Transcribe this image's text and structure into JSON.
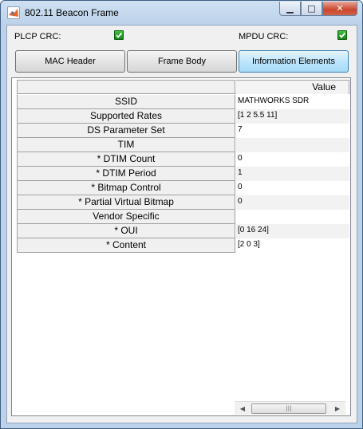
{
  "window": {
    "title": "802.11 Beacon Frame",
    "controls": {
      "minimize": "▁",
      "maximize": "□",
      "close": "✕"
    }
  },
  "crc": {
    "plcp_label": "PLCP CRC:",
    "plcp_checked": true,
    "mpdu_label": "MPDU CRC:",
    "mpdu_checked": true
  },
  "tabs": [
    {
      "label": "MAC Header",
      "active": false
    },
    {
      "label": "Frame Body",
      "active": false
    },
    {
      "label": "Information Elements",
      "active": true
    }
  ],
  "table": {
    "column_header": "Value",
    "rows": [
      {
        "name": "SSID",
        "value": "MATHWORKS SDR"
      },
      {
        "name": "Supported Rates",
        "value": "[1 2 5.5 11]"
      },
      {
        "name": "DS Parameter Set",
        "value": "7"
      },
      {
        "name": "TIM",
        "value": ""
      },
      {
        "name": "* DTIM Count",
        "value": "0"
      },
      {
        "name": "* DTIM Period",
        "value": "1"
      },
      {
        "name": "* Bitmap Control",
        "value": "0"
      },
      {
        "name": "* Partial Virtual Bitmap",
        "value": "0"
      },
      {
        "name": "Vendor Specific",
        "value": ""
      },
      {
        "name": "* OUI",
        "value": "[0 16 24]"
      },
      {
        "name": "* Content",
        "value": "[2 0 3]"
      }
    ]
  },
  "scrollbar": {
    "left_arrow": "◀",
    "right_arrow": "▶",
    "grip": "|||"
  },
  "colors": {
    "check_green": "#17851a",
    "active_tab": "#bee6fd",
    "titlebar": "#bcd2ea"
  }
}
